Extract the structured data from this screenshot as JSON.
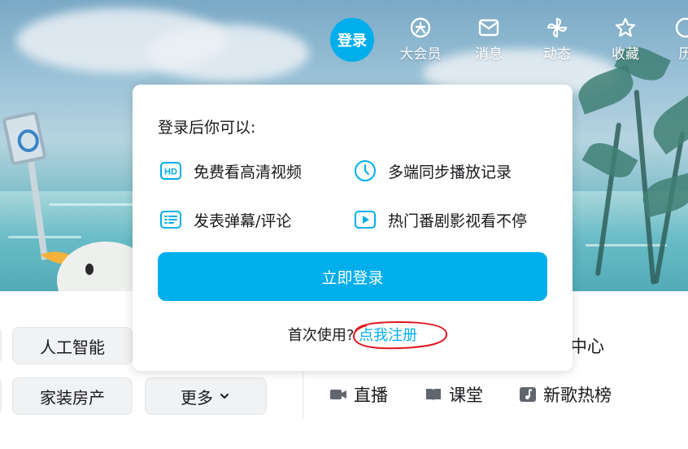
{
  "header": {
    "login_label": "登录",
    "nav_items": [
      {
        "label": "大会员",
        "icon": "vip-icon"
      },
      {
        "label": "消息",
        "icon": "message-icon"
      },
      {
        "label": "动态",
        "icon": "dynamic-icon"
      },
      {
        "label": "收藏",
        "icon": "star-icon"
      },
      {
        "label": "历",
        "icon": "history-icon"
      }
    ]
  },
  "categories": {
    "row1": [
      "人工智能"
    ],
    "row2": [
      "家装房产",
      "更多"
    ],
    "right_partial": "区中心",
    "right_links": [
      {
        "label": "直播",
        "icon": "live-icon"
      },
      {
        "label": "课堂",
        "icon": "classroom-icon"
      },
      {
        "label": "新歌热榜",
        "icon": "music-icon"
      }
    ]
  },
  "login_popup": {
    "title": "登录后你可以:",
    "features": [
      {
        "label": "免费看高清视频",
        "icon": "hd-icon"
      },
      {
        "label": "多端同步播放记录",
        "icon": "clock-icon"
      },
      {
        "label": "发表弹幕/评论",
        "icon": "danmaku-icon"
      },
      {
        "label": "热门番剧影视看不停",
        "icon": "play-icon"
      }
    ],
    "login_button": "立即登录",
    "first_use": "首次使用?",
    "register_link": "点我注册"
  },
  "colors": {
    "accent": "#00aeec",
    "annotation": "#e0141e"
  }
}
